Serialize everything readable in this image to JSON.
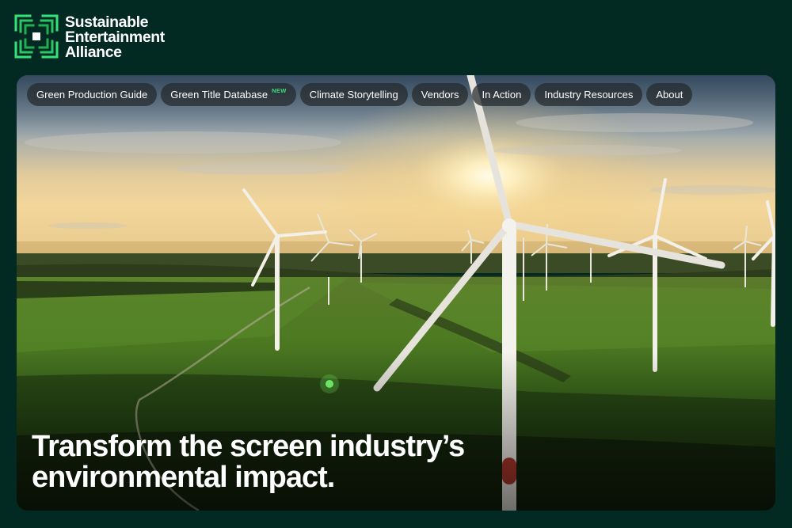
{
  "brand": {
    "name_line1": "Sustainable",
    "name_line2": "Entertainment",
    "name_line3": "Alliance",
    "logo_icon": "green-bracket-frame-logo"
  },
  "colors": {
    "background": "#032a22",
    "accent": "#37e27a",
    "nav_pill": "#22282a"
  },
  "nav": {
    "items": [
      {
        "label": "Green Production Guide"
      },
      {
        "label": "Green Title Database",
        "badge": "NEW"
      },
      {
        "label": "Climate Storytelling"
      },
      {
        "label": "Vendors"
      },
      {
        "label": "In Action"
      },
      {
        "label": "Industry Resources"
      },
      {
        "label": "About"
      }
    ]
  },
  "hero": {
    "headline_line1": "Transform the screen industry’s",
    "headline_line2": "environmental impact.",
    "image_subject": "wind-turbines-at-sunset"
  }
}
